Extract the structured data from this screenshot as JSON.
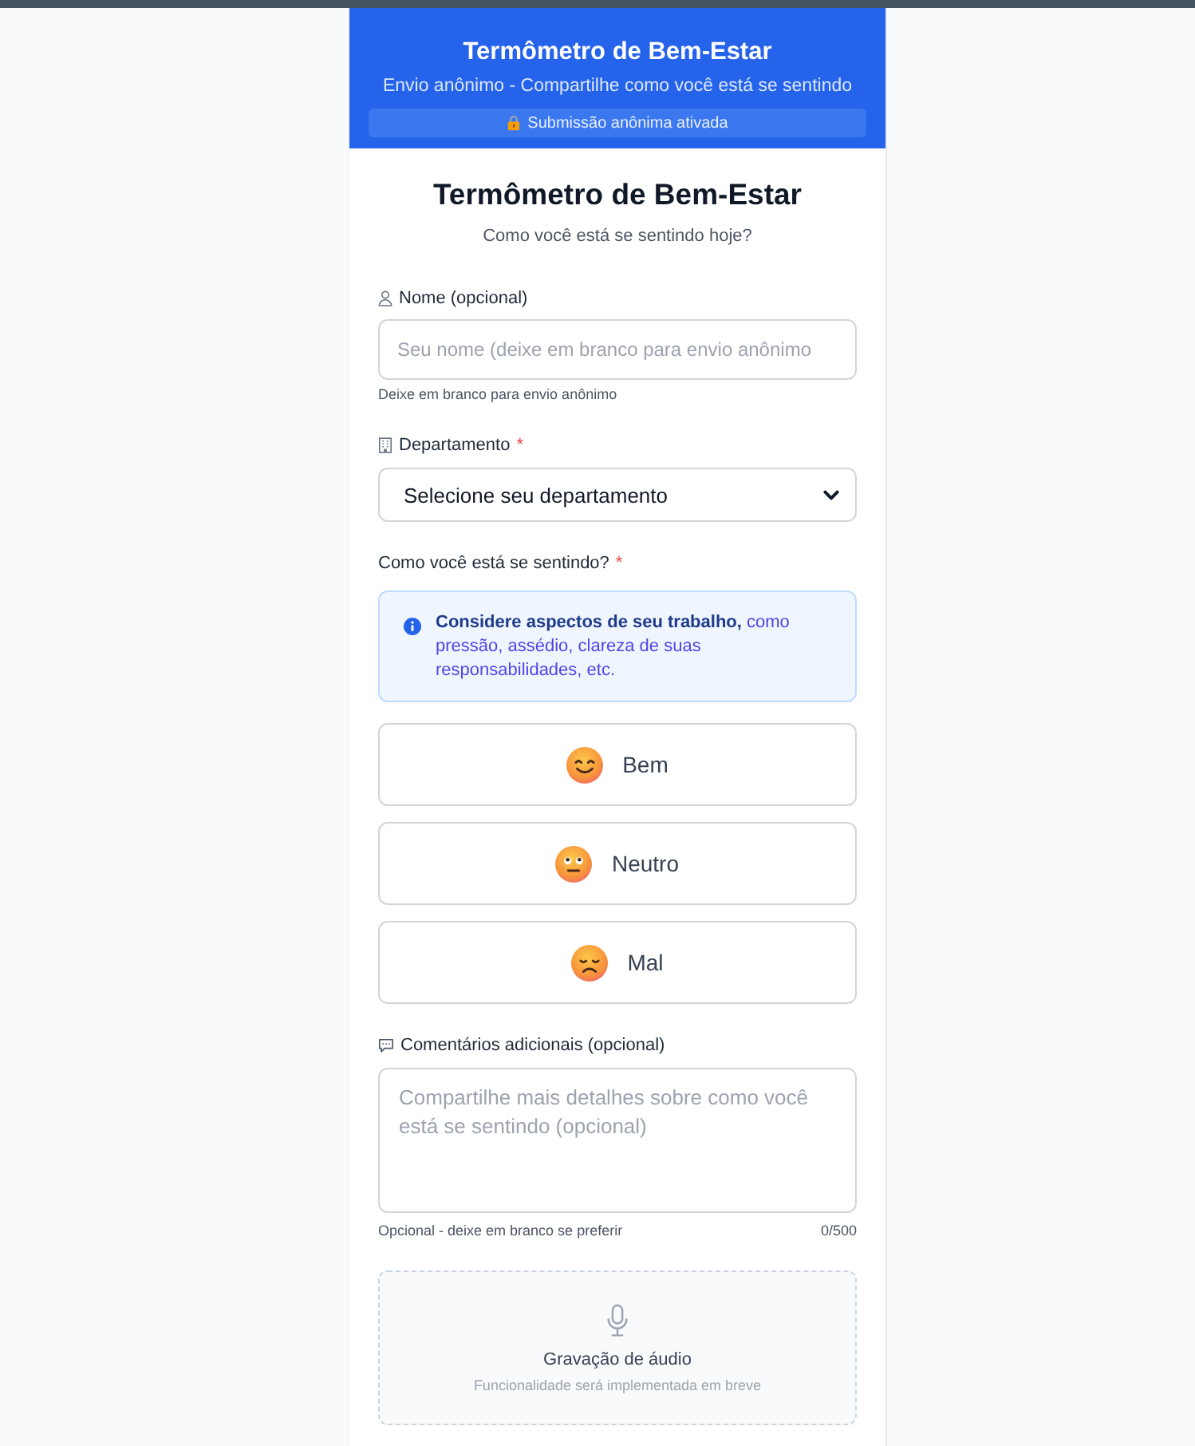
{
  "header": {
    "title": "Termômetro de Bem-Estar",
    "subtitle": "Envio anônimo - Compartilhe como você está se sentindo",
    "badge": "Submissão anônima ativada"
  },
  "intro": {
    "title": "Termômetro de Bem-Estar",
    "subtitle": "Como você está se sentindo hoje?"
  },
  "name_field": {
    "label": "Nome (opcional)",
    "placeholder": "Seu nome (deixe em branco para envio anônimo",
    "hint": "Deixe em branco para envio anônimo"
  },
  "department": {
    "label": "Departamento",
    "required_mark": "*",
    "value": "Selecione seu departamento"
  },
  "mood": {
    "label": "Como você está se sentindo?",
    "required_mark": "*",
    "info": "**Considere aspectos de seu trabalho,** como pressão, assédio, clareza de suas responsabilidades, etc.",
    "options": [
      {
        "label": "Bem",
        "selected": false
      },
      {
        "label": "Neutro",
        "selected": false
      },
      {
        "label": "Mal",
        "selected": false
      }
    ]
  },
  "comments": {
    "label": "Comentários adicionais (opcional)",
    "placeholder": "Compartilhe mais detalhes sobre como você está se sentindo (opcional)",
    "hint": "Opcional - deixe em branco se preferir",
    "counter": "0/500"
  },
  "audio": {
    "title": "Gravação de áudio",
    "note": "Funcionalidade será implementada em breve"
  }
}
